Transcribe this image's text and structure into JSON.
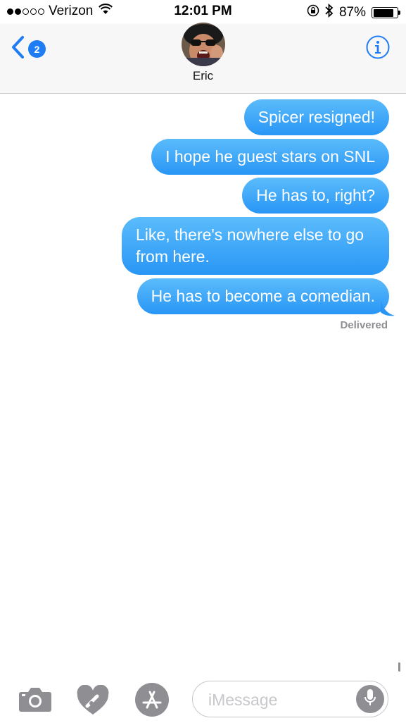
{
  "status_bar": {
    "carrier": "Verizon",
    "signal_bars_filled": 2,
    "signal_bars_total": 5,
    "time": "12:01 PM",
    "battery_percent": "87%",
    "battery_level": 0.87
  },
  "header": {
    "back_badge_count": "2",
    "contact_name": "Eric",
    "accent_color": "#1e7cf4"
  },
  "messages": [
    {
      "text": "Spicer resigned!"
    },
    {
      "text": "I hope he guest stars on SNL"
    },
    {
      "text": "He has to, right?"
    },
    {
      "text": "Like, there's nowhere else to go from here."
    },
    {
      "text": "He has to become a comedian."
    }
  ],
  "delivery_status": "Delivered",
  "bubble_color": "#2d9bf7",
  "input_bar": {
    "placeholder": "iMessage",
    "icons": [
      "camera-icon",
      "digital-touch-icon",
      "app-store-icon",
      "microphone-icon"
    ]
  }
}
